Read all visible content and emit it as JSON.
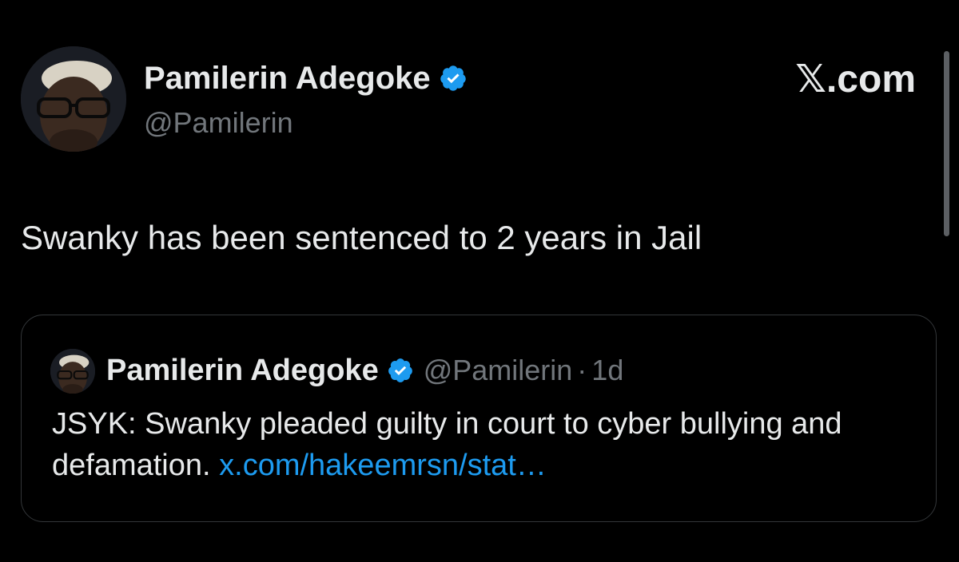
{
  "header": {
    "author_name": "Pamilerin Adegoke",
    "author_handle": "@Pamilerin",
    "brand": "𝕏.com",
    "verified_icon": "verified-badge-icon",
    "avatar_icon": "avatar-photo-icon"
  },
  "tweet": {
    "text": "Swanky has been sentenced to 2 years in Jail"
  },
  "quote": {
    "author_name": "Pamilerin Adegoke",
    "author_handle": "@Pamilerin",
    "separator": "·",
    "time": "1d",
    "body_text": "JSYK: Swanky pleaded guilty in court to cyber bullying and defamation.",
    "link_text": "x.com/hakeemrsn/stat…"
  },
  "colors": {
    "background": "#000000",
    "text_primary": "#e7e9ea",
    "text_secondary": "#71767b",
    "link": "#1d9bf0",
    "verified": "#1d9bf0",
    "border": "#333639"
  }
}
